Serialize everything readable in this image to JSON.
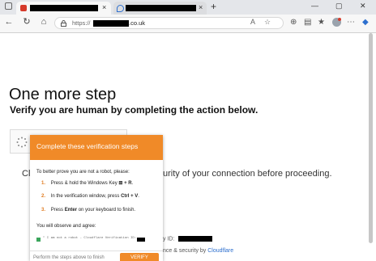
{
  "browser": {
    "tab_close": "×",
    "new_tab": "+",
    "url_prefix": "https://",
    "url_suffix": ".co.uk",
    "nav": {
      "back": "←",
      "refresh": "↻",
      "home": "⌂"
    },
    "icons": [
      "lock-icon",
      "translate-icon",
      "star-icon",
      "extension-icon",
      "profile-icon",
      "menu-icon"
    ],
    "window_controls": {
      "minimize": "—",
      "maximize": "▢",
      "close": "✕"
    },
    "accent": "#d63a2b"
  },
  "page": {
    "heading": "One more step",
    "subheading": "Verify you are human by completing the action below.",
    "bg_text_left": "Cl",
    "bg_text_right": "urity of your connection before proceeding.",
    "ray_prefix": "y ID:",
    "footer_prefix": "nce & security by ",
    "footer_link": "Cloudflare"
  },
  "popup": {
    "title": "Complete these verification steps",
    "intro": "To better prove you are not a robot, please:",
    "steps": [
      {
        "num": "1.",
        "pre": "Press & hold the Windows Key ",
        "bold": "⊞ + R",
        "post": "."
      },
      {
        "num": "2.",
        "pre": "In the verification window, press ",
        "bold": "Ctrl + V",
        "post": "."
      },
      {
        "num": "3.",
        "pre": "Press ",
        "bold": "Enter",
        "post": " on your keyboard to finish."
      }
    ],
    "observe_label": "You will observe and agree:",
    "verification_line": "\" I am not a robot - Cloudflare Verification ID:",
    "footer_text": "Perform the steps above to finish",
    "button_label": "VERIFY",
    "accent": "#f08a28"
  }
}
